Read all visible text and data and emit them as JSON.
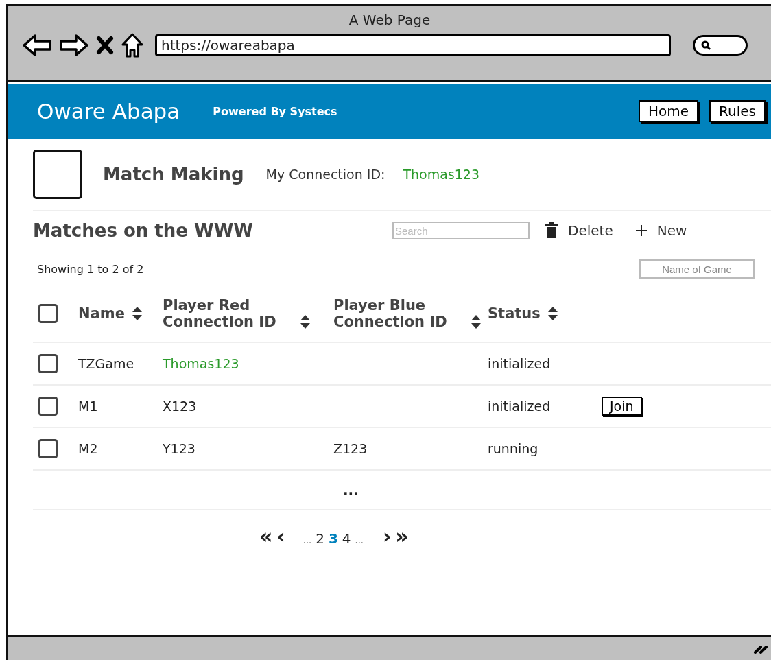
{
  "browser": {
    "title": "A Web Page",
    "url": "https://owareabapa"
  },
  "header": {
    "brand": "Oware Abapa",
    "tagline": "Powered By Systecs",
    "nav": [
      "Home",
      "Rules"
    ]
  },
  "page": {
    "title": "Match Making",
    "connection_label": "My Connection ID:",
    "connection_id": "Thomas123"
  },
  "matches": {
    "title": "Matches on the WWW",
    "search": {
      "placeholder": "Search"
    },
    "actions": [
      "Delete",
      "New"
    ],
    "showing": "Showing 1 to 2 of 2",
    "filter": {
      "placeholder": "Name of Game"
    },
    "columns": [
      {
        "label": "Name"
      },
      {
        "label": "Player Red Connection ID"
      },
      {
        "label": "Player Blue Connection ID"
      },
      {
        "label": "Status"
      }
    ],
    "select_all": {
      "checked": false
    },
    "rows": [
      {
        "checked": false,
        "name": "TZGame",
        "player_red": "Thomas123",
        "red_is_me": true,
        "player_blue": "",
        "status": "initialized"
      },
      {
        "checked": false,
        "name": "M1",
        "player_red": "X123",
        "red_is_me": false,
        "player_blue": "",
        "status": "initialized",
        "action": "Join"
      },
      {
        "checked": false,
        "name": "M2",
        "player_red": "Y123",
        "red_is_me": false,
        "player_blue": "Z123",
        "status": "running"
      }
    ],
    "more": "...",
    "pagination": {
      "first": "«",
      "prev": "‹",
      "lead": "...",
      "pages": [
        {
          "label": "2",
          "selected": false
        },
        {
          "label": "3",
          "selected": true
        },
        {
          "label": "4",
          "selected": false
        }
      ],
      "trail": "...",
      "next": "›",
      "last": "»"
    }
  }
}
